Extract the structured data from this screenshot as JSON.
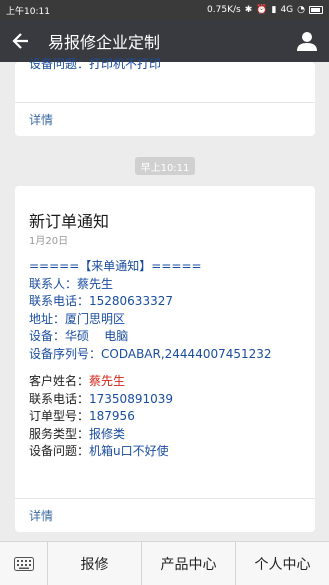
{
  "status_bar": {
    "time": "上午10:11",
    "net_speed": "0.75K/s",
    "network": "4G"
  },
  "header": {
    "title": "易报修企业定制",
    "back_icon": "back-arrow-icon",
    "profile_icon": "person-icon"
  },
  "prev_card": {
    "last_line": "设备问题：打印机不打印",
    "details_label": "详情"
  },
  "time_divider": "早上10:11",
  "notice_card": {
    "title": "新订单通知",
    "date": "1月20日",
    "banner": "=====【来单通知】=====",
    "contact_person": "联系人：蔡先生",
    "contact_phone": "联系电话：15280633327",
    "address": "地址：厦门思明区",
    "device": "设备：华硕    电脑",
    "serial": "设备序列号：CODABAR,24444007451232",
    "customer_label": "客户姓名：",
    "customer_value": "蔡先生",
    "phone2_label": "联系电话：",
    "phone2_value": "17350891039",
    "order_label": "订单型号：",
    "order_value": "187956",
    "service_label": "服务类型：",
    "service_value": "报修类",
    "problem_label": "设备问题：",
    "problem_value": "机箱u口不好使",
    "details_label": "详情"
  },
  "bottom_menu": {
    "keyboard_icon": "keyboard-icon",
    "items": [
      "报修",
      "产品中心",
      "个人中心"
    ]
  }
}
